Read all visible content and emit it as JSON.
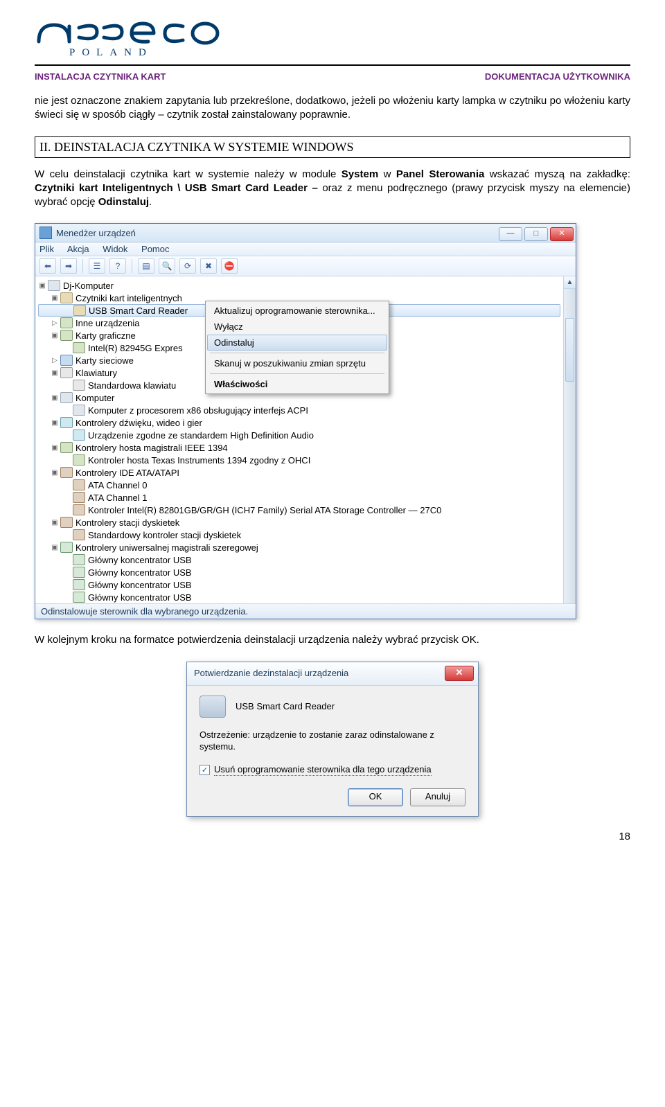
{
  "logo_sub": "POLAND",
  "header_left": "INSTALACJA CZYTNIKA KART",
  "header_right": "DOKUMENTACJA  UŻYTKOWNIKA",
  "para1": "nie jest oznaczone znakiem zapytania lub przekreślone, dodatkowo, jeżeli po włożeniu karty lampka w czytniku po włożeniu karty świeci się w sposób ciągły – czytnik został zainstalowany poprawnie.",
  "section2_title": "II. DEINSTALACJA CZYTNIKA W SYSTEMIE WINDOWS",
  "para2_a": "W celu deinstalacji czytnika kart w systemie należy w module ",
  "para2_b": "System",
  "para2_c": " w ",
  "para2_d": "Panel Sterowania",
  "para2_e": " wskazać myszą na zakładkę: ",
  "para2_f": "Czytniki kart Inteligentnych \\ USB Smart Card Leader – ",
  "para2_g": "oraz z menu podręcznego (prawy przycisk myszy na elemencie) wybrać opcję ",
  "para2_h": "Odinstaluj",
  "para2_i": ".",
  "devmgr": {
    "title": "Menedżer urządzeń",
    "menu": {
      "plik": "Plik",
      "akcja": "Akcja",
      "widok": "Widok",
      "pomoc": "Pomoc"
    },
    "status": "Odinstalowuje sterownik dla wybranego urządzenia.",
    "tree": {
      "root": "Dj-Komputer",
      "smartcards": "Czytniki kart inteligentnych",
      "usb_reader": "USB Smart Card Reader",
      "other": "Inne urządzenia",
      "gfx": "Karty graficzne",
      "gfx_item": "Intel(R) 82945G Expres",
      "net": "Karty sieciowe",
      "kbd": "Klawiatury",
      "kbd_item": "Standardowa klawiatu",
      "comp": "Komputer",
      "comp_item": "Komputer z procesorem x86 obsługujący interfejs ACPI",
      "snd": "Kontrolery dźwięku, wideo i gier",
      "snd_item": "Urządzenie zgodne ze standardem High Definition Audio",
      "ieee": "Kontrolery hosta magistrali IEEE 1394",
      "ieee_item": "Kontroler hosta Texas Instruments 1394 zgodny z OHCI",
      "ide": "Kontrolery IDE ATA/ATAPI",
      "ide0": "ATA Channel 0",
      "ide1": "ATA Channel 1",
      "ide_ctrl": "Kontroler Intel(R) 82801GB/GR/GH (ICH7 Family) Serial ATA Storage Controller — 27C0",
      "fdc": "Kontrolery stacji dyskietek",
      "fdc_item": "Standardowy kontroler stacji dyskietek",
      "usb": "Kontrolery uniwersalnej magistrali szeregowej",
      "usb_hub": "Główny koncentrator USB"
    },
    "context": {
      "update": "Aktualizuj oprogramowanie sterownika...",
      "disable": "Wyłącz",
      "uninstall": "Odinstaluj",
      "scan": "Skanuj w poszukiwaniu zmian sprzętu",
      "props": "Właściwości"
    }
  },
  "para3": "W kolejnym kroku na formatce potwierdzenia deinstalacji urządzenia należy wybrać przycisk OK.",
  "dialog": {
    "title": "Potwierdzanie dezinstalacji urządzenia",
    "device": "USB Smart Card Reader",
    "warn": "Ostrzeżenie: urządzenie to zostanie zaraz odinstalowane z systemu.",
    "checkbox": "Usuń oprogramowanie sterownika dla tego urządzenia",
    "ok": "OK",
    "cancel": "Anuluj"
  },
  "page_number": "18"
}
